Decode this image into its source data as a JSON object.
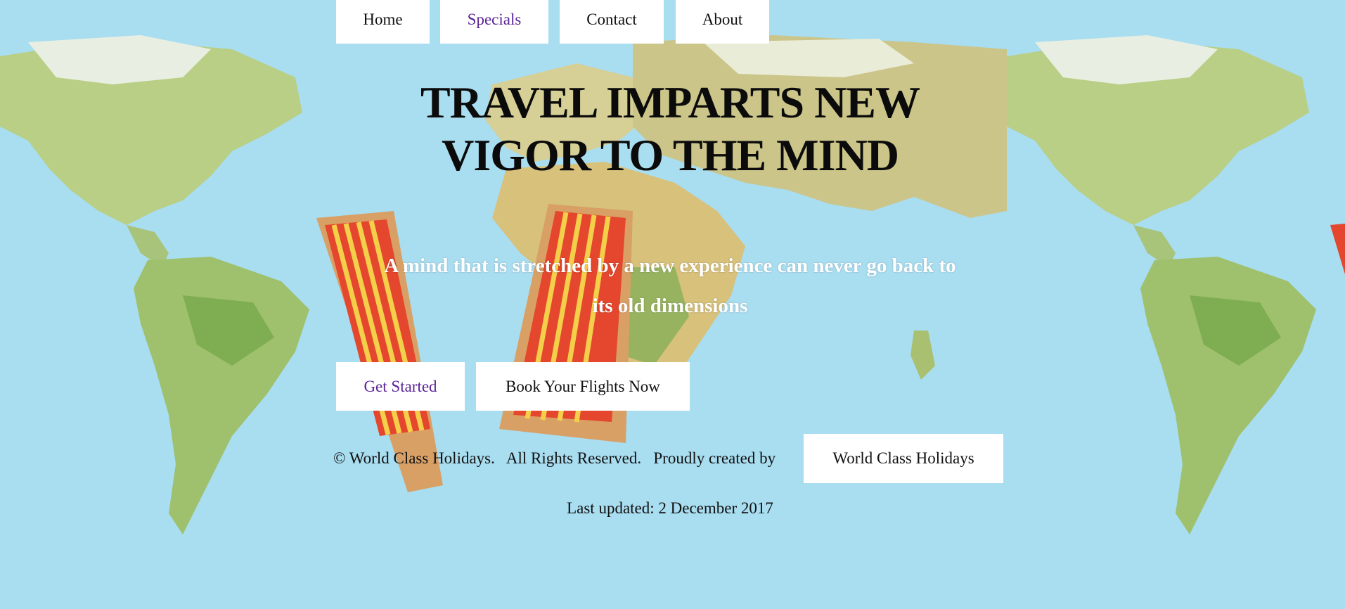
{
  "nav": {
    "items": [
      {
        "label": "Home"
      },
      {
        "label": "Specials"
      },
      {
        "label": "Contact"
      },
      {
        "label": "About"
      }
    ]
  },
  "hero": {
    "headline_line1": "TRAVEL IMPARTS NEW",
    "headline_line2": "VIGOR TO THE MIND",
    "tagline_line1": "A mind that is stretched by a new experience can never go back to",
    "tagline_line2": "its old dimensions"
  },
  "actions": {
    "get_started": "Get Started",
    "book_flights": "Book Your Flights Now"
  },
  "footer": {
    "copyright": "© World Class Holidays.   All Rights Reserved.   Proudly created by",
    "creator_link": "World Class Holidays",
    "last_updated": "Last updated: 2 December 2017"
  },
  "colors": {
    "visited_link": "#5b2597",
    "ocean": "#a8dcef",
    "tagline_text": "#ffffff"
  }
}
